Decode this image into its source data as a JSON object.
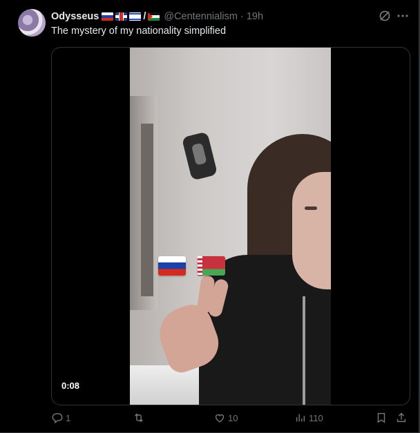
{
  "tweet": {
    "display_name": "Odysseus",
    "handle": "@Centennialism",
    "separator": "·",
    "time": "19h",
    "slash": "/",
    "text": "The mystery of my nationality simplified",
    "name_flags": [
      "russia-flag",
      "uk-flag",
      "israel-flag",
      "palestine-flag"
    ]
  },
  "media": {
    "duration": "0:08",
    "overlay_flags": [
      "russia-flag",
      "belarus-flag"
    ]
  },
  "actions": {
    "reply_count": "1",
    "retweet_count": "",
    "like_count": "10",
    "view_count": "110"
  },
  "icons": {
    "top_right": [
      "grok-icon",
      "more-icon"
    ],
    "bottom": [
      "reply-icon",
      "retweet-icon",
      "like-icon",
      "views-icon",
      "bookmark-icon",
      "share-icon"
    ]
  },
  "colors": {
    "background": "#000000",
    "text_primary": "#e7e9ea",
    "text_secondary": "#71767b",
    "border": "#2f3336"
  }
}
